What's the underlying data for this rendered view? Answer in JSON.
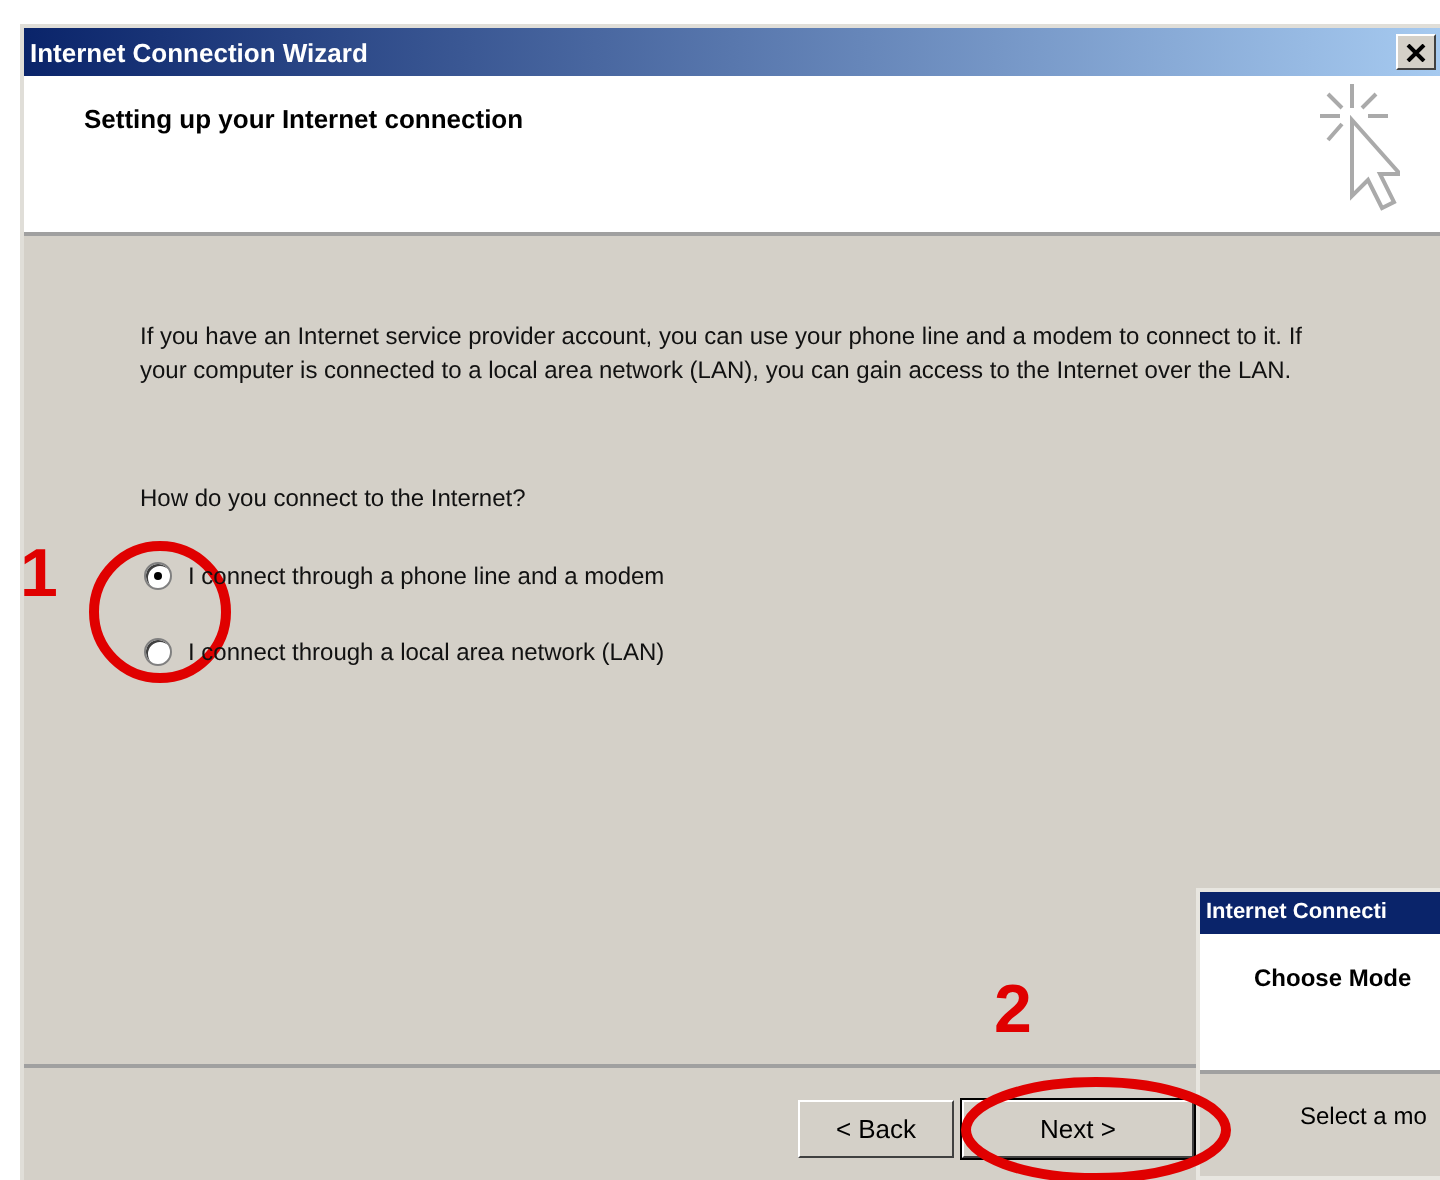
{
  "window": {
    "title": "Internet Connection Wizard"
  },
  "header": {
    "title": "Setting up your Internet connection"
  },
  "intro": "If you have an Internet service provider account, you can use your phone line and a modem to connect to it. If your computer is connected to a local area network (LAN), you can gain access to the Internet over the LAN.",
  "question": "How do you connect to the Internet?",
  "options": [
    {
      "label": "I connect through a phone line and a modem",
      "selected": true
    },
    {
      "label": "I connect through a local area network (LAN)",
      "selected": false
    }
  ],
  "buttons": [
    {
      "label": "< Back",
      "kind": "back"
    },
    {
      "label": "Next >",
      "kind": "next"
    }
  ],
  "next_window": {
    "title": "Internet Connecti",
    "header": "Choose Mode",
    "text": "Select a mo"
  },
  "annotations": [
    {
      "label": "1",
      "kind": "circle"
    },
    {
      "label": "2",
      "kind": "ellipse"
    }
  ]
}
